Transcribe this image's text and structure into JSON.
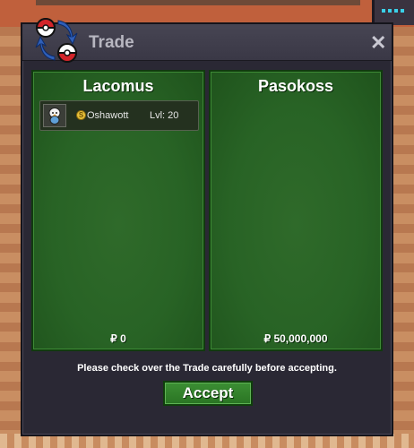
{
  "window": {
    "title": "Trade",
    "close_label": "✕",
    "icon": "trade-swap-icon"
  },
  "left_panel": {
    "player": "Lacomus",
    "money": "₽ 0",
    "pokemon": {
      "coin_symbol": "S",
      "name": "Oshawott",
      "level": "Lvl: 20",
      "sprite": "oshawott-sprite-icon"
    }
  },
  "right_panel": {
    "player": "Pasokoss",
    "money": "₽ 50,000,000"
  },
  "notice": "Please check over the Trade carefully before accepting.",
  "accept_label": "Accept",
  "colors": {
    "panel_green": "#286325",
    "window_bg": "#2a2834",
    "titlebar": "#3f3d4b",
    "accent_red": "#d2242a",
    "accent_blue": "#2f5fb8"
  }
}
